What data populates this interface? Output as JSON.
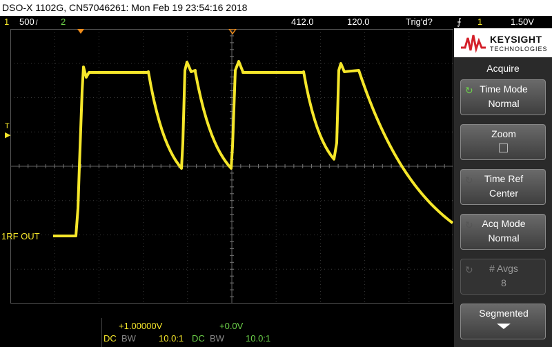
{
  "title_bar": "DSO-X 1102G, CN57046261: Mon Feb 19 23:54:16 2018",
  "status": {
    "ch1_number": "1",
    "ch1_scale": "500",
    "ch1_unit": " /",
    "ch2_number": "2",
    "time_delay": "412.0",
    "time_scale": "120.0",
    "trigger_state": "Trig'd?",
    "trigger_source": "1",
    "trigger_level": "1.50V"
  },
  "plot": {
    "label_t": "T",
    "ch1_label": "1",
    "rf_out_label": "RF  OUT"
  },
  "panel": {
    "brand": "KEYSIGHT",
    "brand_sub": "TECHNOLOGIES",
    "menu_title": "Acquire",
    "softkeys": [
      {
        "line1": "Time Mode",
        "line2": "Normal"
      },
      {
        "line1": "Zoom",
        "line2": ""
      },
      {
        "line1": "Time Ref",
        "line2": "Center"
      },
      {
        "line1": "Acq Mode",
        "line2": "Normal"
      },
      {
        "line1": "# Avgs",
        "line2": "8"
      },
      {
        "line1": "Segmented",
        "line2": ""
      }
    ]
  },
  "channels": {
    "ch1_offset": "+1.00000V",
    "ch2_offset": "+0.0V",
    "ch1_coupling": "DC",
    "ch1_bw": "BW",
    "ch1_probe": "10.0:1",
    "ch2_coupling": "DC",
    "ch2_bw": "BW",
    "ch2_probe": "10.0:1"
  },
  "colors": {
    "ch1": "#f5e62a",
    "ch2": "#6dd34a",
    "trigger_marker": "#f08c1a",
    "grid": "#555555"
  }
}
